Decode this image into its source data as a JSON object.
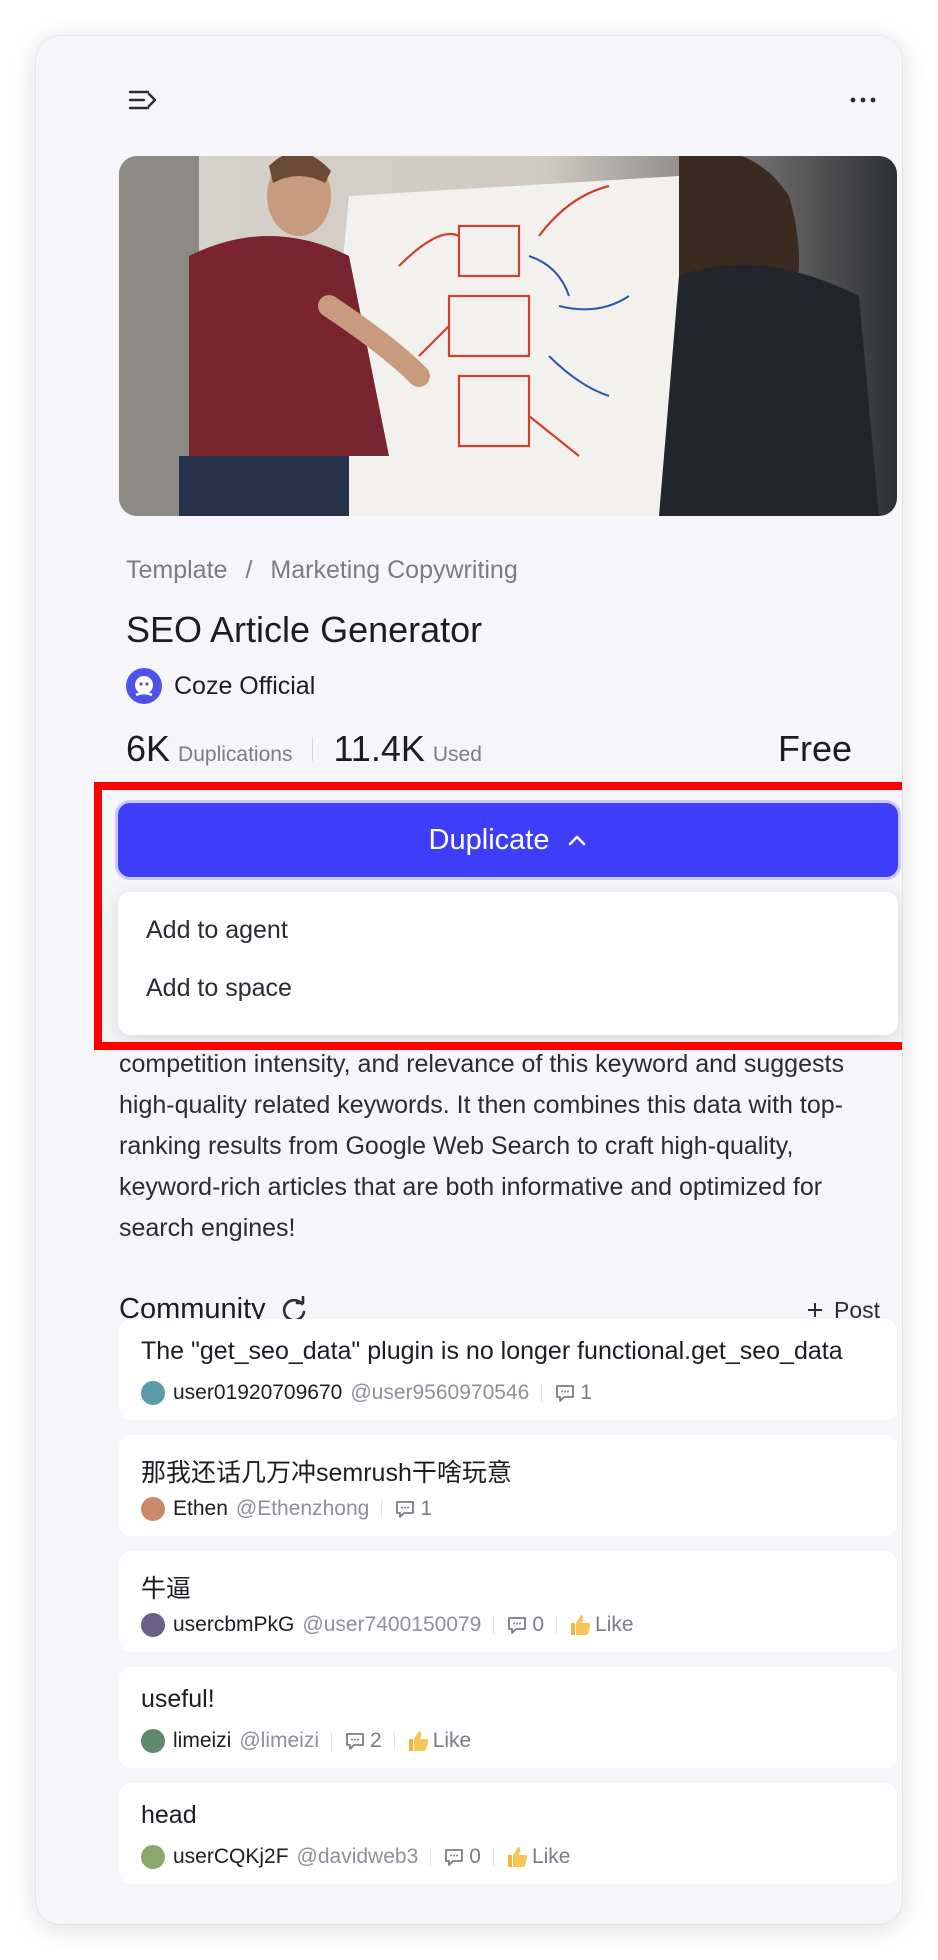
{
  "breadcrumb": {
    "root": "Template",
    "separator": "/",
    "category": "Marketing Copywriting"
  },
  "title": "SEO Article Generator",
  "author": {
    "name": "Coze Official"
  },
  "stats": {
    "duplications_value": "6K",
    "duplications_label": "Duplications",
    "used_value": "11.4K",
    "used_label": "Used",
    "price": "Free"
  },
  "duplicate": {
    "label": "Duplicate",
    "menu": [
      "Add to agent",
      "Add to space"
    ]
  },
  "description": "competition intensity, and relevance of this keyword and suggests high-quality related keywords. It then combines this data with top-ranking results from Google Web Search to craft high-quality, keyword-rich articles that are both informative and optimized for search engines!",
  "community": {
    "title": "Community",
    "post_label": "Post",
    "posts": [
      {
        "text": "The \"get_seo_data\" plugin is no longer functional.get_seo_data",
        "user": "user01920709670",
        "handle": "@user9560970546",
        "comments": "1",
        "like": ""
      },
      {
        "text": "那我还话几万冲semrush干啥玩意",
        "user": "Ethen",
        "handle": "@Ethenzhong",
        "comments": "1",
        "like": ""
      },
      {
        "text": "牛逼",
        "user": "usercbmPkG",
        "handle": "@user7400150079",
        "comments": "0",
        "like": "Like"
      },
      {
        "text": "useful!",
        "user": "limeizi",
        "handle": "@limeizi",
        "comments": "2",
        "like": "Like"
      },
      {
        "text": "head",
        "user": "userCQKj2F",
        "handle": "@davidweb3",
        "comments": "0",
        "like": "Like"
      }
    ]
  },
  "colors": {
    "accent": "#3d3dfa",
    "highlight": "#ff0000",
    "background": "#f5f5fa"
  },
  "icons": [
    "menu-toggle-icon",
    "more-icon",
    "chevron-up-icon",
    "refresh-icon",
    "plus-icon",
    "comment-icon",
    "thumbs-up-icon"
  ]
}
